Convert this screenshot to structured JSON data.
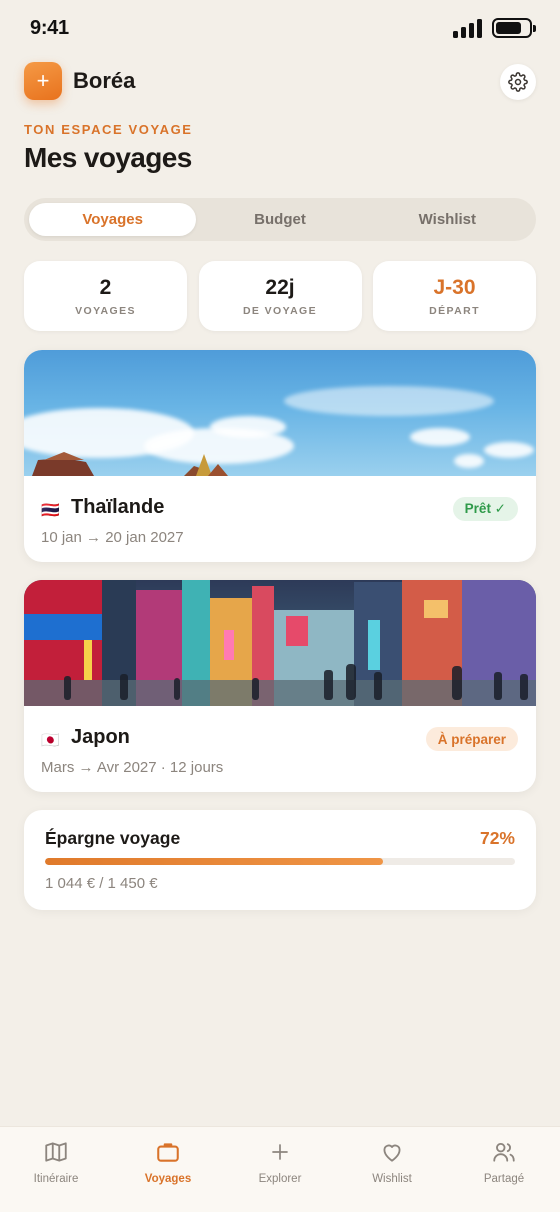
{
  "status_bar": {
    "time": "9:41",
    "battery_level": 0.78
  },
  "header": {
    "logo_glyph": "+",
    "app_name": "Boréa",
    "settings_icon": "gear-icon"
  },
  "eyebrow": "TON ESPACE VOYAGE",
  "title": "Mes voyages",
  "tabs": [
    {
      "label": "Voyages",
      "active": true
    },
    {
      "label": "Budget",
      "active": false
    },
    {
      "label": "Wishlist",
      "active": false
    }
  ],
  "stats": [
    {
      "value": "2",
      "label": "VOYAGES"
    },
    {
      "value": "22j",
      "label": "DE VOYAGE"
    },
    {
      "value": "J-30",
      "label": "DÉPART"
    }
  ],
  "trips": [
    {
      "flag": "🇹🇭",
      "name": "Thaïlande",
      "dates": "10 jan → 20 jan 2027",
      "status": "Prêt ✓",
      "status_color": "#2f9a4a"
    },
    {
      "flag": "🇯🇵",
      "name": "Japon",
      "dates": "Mars → Avr 2027 · 12 jours",
      "status": "À préparer",
      "status_color": "#d9732a"
    }
  ],
  "savings": {
    "title": "Épargne voyage",
    "percent_label": "72%",
    "progress": 0.72,
    "amount": "1 044 € / 1 450 €"
  },
  "tab_bar": [
    {
      "label": "Itinéraire",
      "icon": "map-icon",
      "active": false
    },
    {
      "label": "Voyages",
      "icon": "suitcase-icon",
      "active": true
    },
    {
      "label": "Explorer",
      "icon": "plus-icon",
      "active": false
    },
    {
      "label": "Wishlist",
      "icon": "heart-icon",
      "active": false
    },
    {
      "label": "Partagé",
      "icon": "users-icon",
      "active": false
    }
  ],
  "colors": {
    "accent": "#d9732a",
    "background": "#f3efe8",
    "success": "#2f9a4a"
  }
}
